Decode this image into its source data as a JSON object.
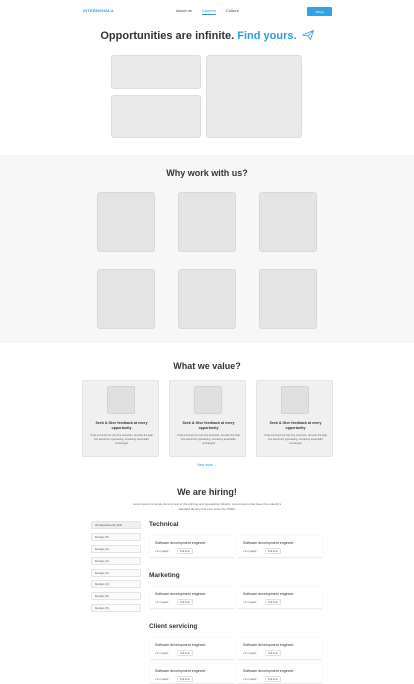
{
  "header": {
    "logo": "INTERNSHALA",
    "nav": [
      "About us",
      "Careers",
      "Culture"
    ],
    "cta": "Hiring"
  },
  "hero": {
    "title_plain": "Opportunities are infinite.",
    "title_highlight": "Find yours."
  },
  "why": {
    "title": "Why work with us?"
  },
  "values": {
    "title": "What we value?",
    "cards": [
      {
        "heading": "Seek & Give feedback at every opportunity",
        "text": "It has survived not only five centuries, but also the leap into electronic typesetting, remaining essentially unchanged"
      },
      {
        "heading": "Seek & Give feedback at every opportunity",
        "text": "It has survived not only five centuries, but also the leap into electronic typesetting, remaining essentially unchanged"
      },
      {
        "heading": "Seek & Give feedback at every opportunity",
        "text": "It has survived not only five centuries, but also the leap into electronic typesetting, remaining essentially unchanged"
      }
    ],
    "view_more": "View more →"
  },
  "hiring": {
    "title": "We are hiring!",
    "subtitle": "Lorem Ipsum is simply dummy text of the printing and typesetting industry. Lorem Ipsum has been the industry's standard dummy text ever since the 1500s,",
    "filters": [
      "All departments (54)",
      "Design (5)",
      "Design (4)",
      "Design (3)",
      "Design (3)",
      "Design (4)",
      "Design (8)",
      "Design (5)"
    ],
    "categories": [
      {
        "name": "Technical",
        "jobs": [
          {
            "title": "Software development engineer",
            "exp": "• 0-1 years",
            "type": "Full time"
          },
          {
            "title": "Software development engineer",
            "exp": "• 0-1 years",
            "type": "Full time"
          }
        ]
      },
      {
        "name": "Marketing",
        "jobs": [
          {
            "title": "Software development engineer",
            "exp": "• 0-1 years",
            "type": "Full time"
          },
          {
            "title": "Software development engineer",
            "exp": "• 0-1 years",
            "type": "Full time"
          }
        ]
      },
      {
        "name": "Client servicing",
        "jobs": [
          {
            "title": "Software development engineer",
            "exp": "• 0-1 years",
            "type": "Full time"
          },
          {
            "title": "Software development engineer",
            "exp": "• 0-1 years",
            "type": "Full time"
          },
          {
            "title": "Software development engineer",
            "exp": "• 0-1 years",
            "type": "Full time"
          },
          {
            "title": "Software development engineer",
            "exp": "• 0-1 years",
            "type": "Full time"
          }
        ]
      }
    ]
  },
  "colors": {
    "accent": "#2d9be0",
    "placeholder": "#e9e9e9",
    "section_bg": "#f7f7f7"
  }
}
